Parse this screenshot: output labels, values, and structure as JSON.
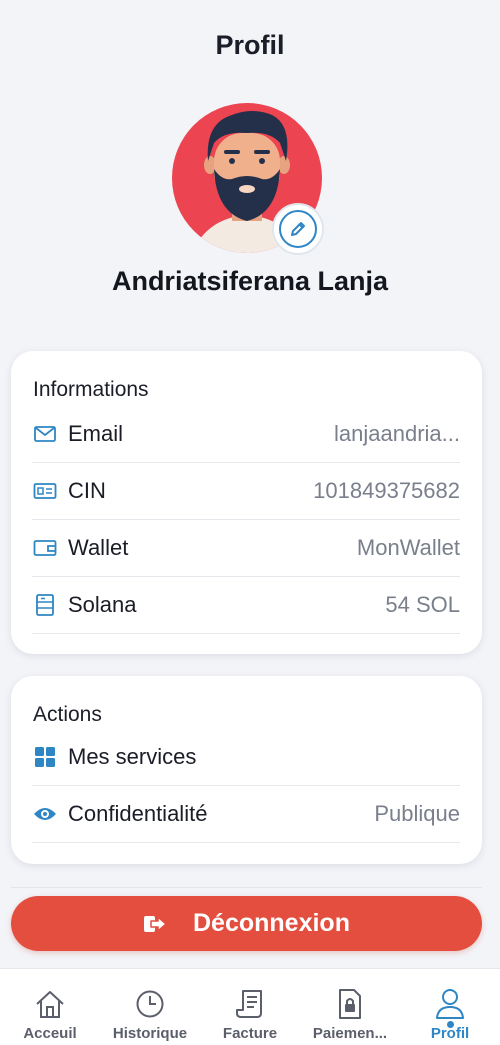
{
  "header": {
    "title": "Profil"
  },
  "profile": {
    "name": "Andriatsiferana Lanja"
  },
  "informations": {
    "title": "Informations",
    "rows": [
      {
        "icon": "mail-icon",
        "label": "Email",
        "value": "lanjaandria..."
      },
      {
        "icon": "id-card-icon",
        "label": "CIN",
        "value": "101849375682"
      },
      {
        "icon": "wallet-icon",
        "label": "Wallet",
        "value": "MonWallet"
      },
      {
        "icon": "server-icon",
        "label": "Solana",
        "value": "54 SOL"
      }
    ]
  },
  "actions": {
    "title": "Actions",
    "rows": [
      {
        "icon": "grid-icon",
        "label": "Mes services",
        "value": ""
      },
      {
        "icon": "eye-icon",
        "label": "Confidentialité",
        "value": "Publique"
      }
    ]
  },
  "logout": {
    "label": "Déconnexion",
    "icon": "logout-icon"
  },
  "nav": {
    "items": [
      {
        "label": "Acceuil",
        "icon": "home-icon"
      },
      {
        "label": "Historique",
        "icon": "clock-icon"
      },
      {
        "label": "Facture",
        "icon": "receipt-icon"
      },
      {
        "label": "Paiemen...",
        "icon": "payment-lock-icon"
      },
      {
        "label": "Profil",
        "icon": "user-icon"
      }
    ],
    "active": "Profil"
  },
  "colors": {
    "accent": "#2e86c5",
    "danger": "#e44e3f",
    "avatar_bg": "#ec4450",
    "background": "#f3f4f8"
  }
}
